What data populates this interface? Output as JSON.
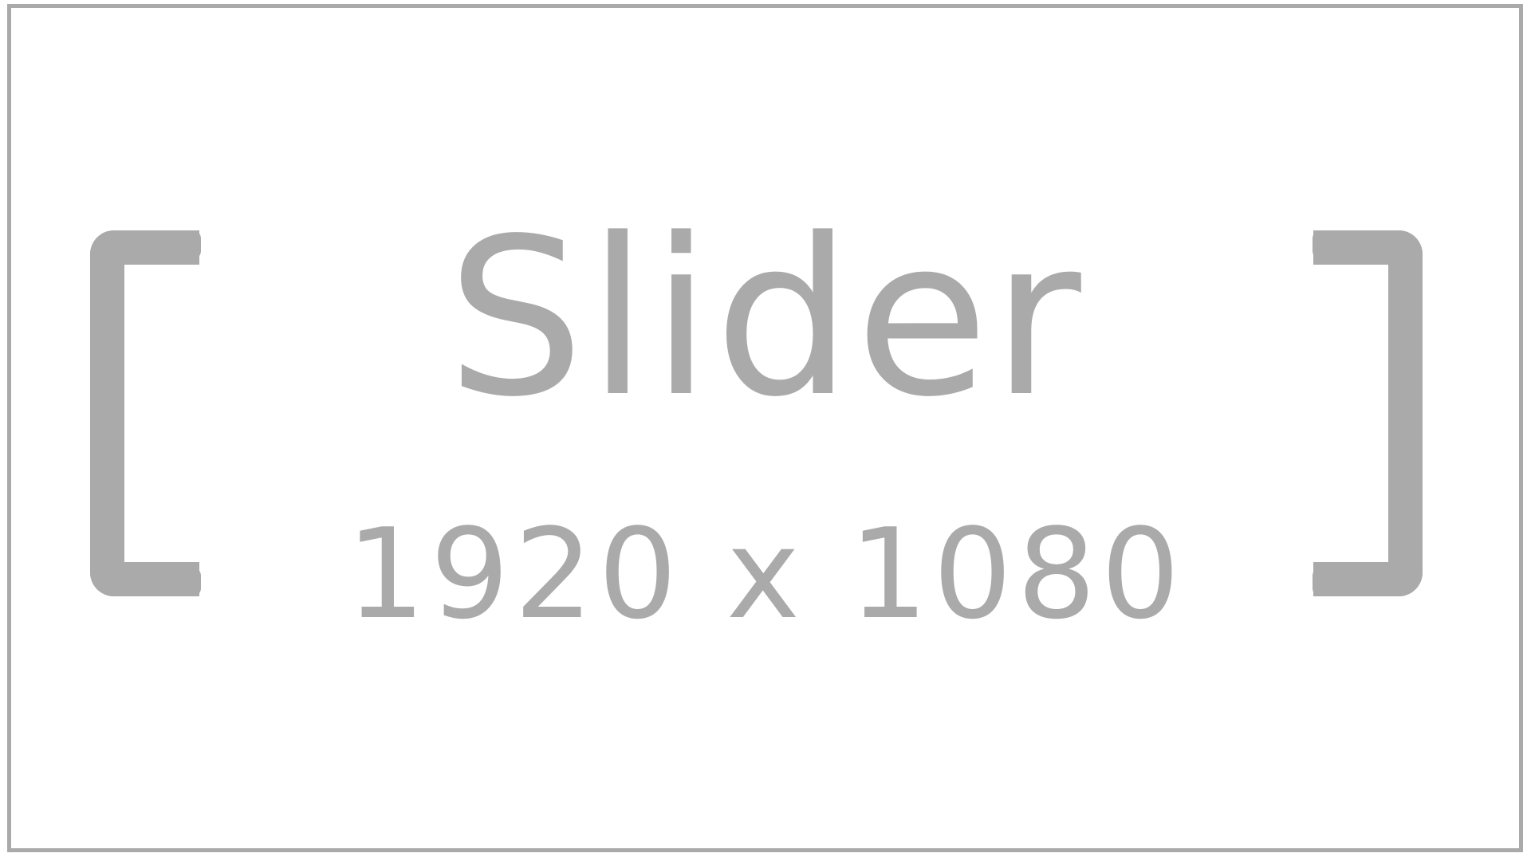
{
  "placeholder": {
    "title": "Slider",
    "dimensions": "1920 x 1080",
    "colors": {
      "foreground": "#aaaaaa",
      "background": "#ffffff"
    }
  }
}
